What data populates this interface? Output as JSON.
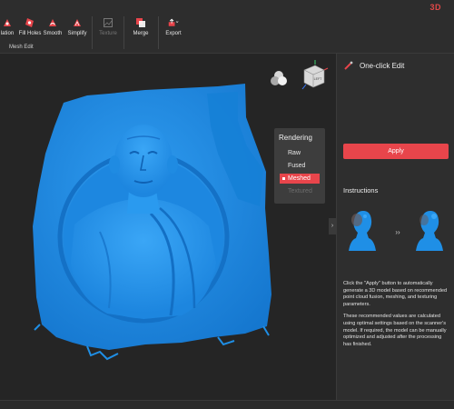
{
  "app": {
    "brand": "3D",
    "accent_color": "#e8454b",
    "model_color": "#1f8fe6"
  },
  "toolbar": {
    "group_label": "Mesh Edit",
    "tools": [
      {
        "label": "lation",
        "icon": "isolation-icon"
      },
      {
        "label": "Fill Holes",
        "icon": "fill-holes-icon"
      },
      {
        "label": "Smooth",
        "icon": "smooth-icon"
      },
      {
        "label": "Simplify",
        "icon": "simplify-icon"
      },
      {
        "label": "Texture",
        "icon": "texture-icon",
        "disabled": true
      },
      {
        "label": "Merge",
        "icon": "merge-icon"
      },
      {
        "label": "Export",
        "icon": "export-icon"
      }
    ]
  },
  "viewport": {
    "view_cube_label": "LEFT",
    "rendering": {
      "title": "Rendering",
      "options": [
        {
          "label": "Raw",
          "state": "normal"
        },
        {
          "label": "Fused",
          "state": "normal"
        },
        {
          "label": "Meshed",
          "state": "active"
        },
        {
          "label": "Textured",
          "state": "disabled"
        }
      ]
    },
    "collapse_glyph": "›"
  },
  "side_panel": {
    "title": "One-click Edit",
    "apply_label": "Apply",
    "instructions_title": "Instructions",
    "arrow_glyph": "››",
    "paragraphs": [
      "Click the \"Apply\" button to automatically generate a 3D model based on recommended point cloud fusion, meshing, and texturing parameters.",
      "These recommended values are calculated using optimal settings based on the scanner's model. If required, the model can be manually optimized and adjusted after the processing has finished."
    ]
  }
}
